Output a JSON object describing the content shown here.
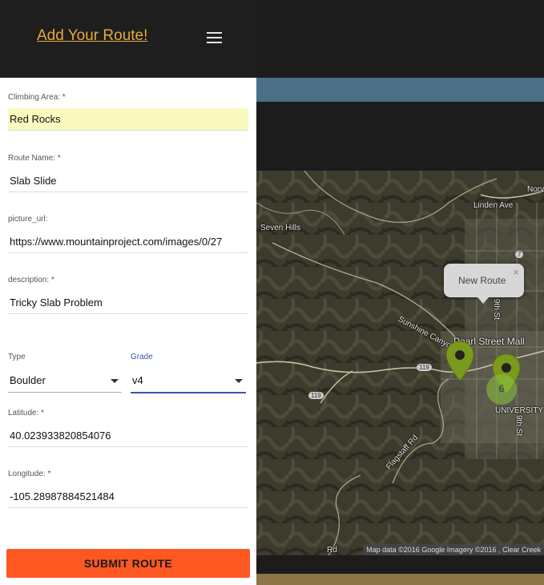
{
  "header": {
    "title": "Add Your Route!",
    "menu_icon": "hamburger-menu-icon"
  },
  "form": {
    "area": {
      "label": "Climbing Area: *",
      "value": "Red Rocks"
    },
    "route_name": {
      "label": "Route Name: *",
      "value": "Slab Slide"
    },
    "picture_url": {
      "label": "picture_url:",
      "value": "https://www.mountainproject.com/images/0/27"
    },
    "description": {
      "label": "description: *",
      "value": "Tricky Slab Problem"
    },
    "type": {
      "label": "Type",
      "value": "Boulder"
    },
    "grade": {
      "label": "Grade",
      "value": "v4"
    },
    "latitude": {
      "label": "Latitude: *",
      "value": "40.023933820854076"
    },
    "longitude": {
      "label": "Longitude: *",
      "value": "-105.28987884521484"
    },
    "submit_label": "SUBMIT ROUTE"
  },
  "map": {
    "labels": {
      "seven_hills": "Seven Hills",
      "linden_ave": "Linden Ave",
      "sunshine_canyon": "Sunshine Canyon Dr",
      "pearl_street": "Pearl Street Mall",
      "flagstaff": "Flagstaff Rd",
      "university": "UNIVERSITY",
      "nor": "Norv",
      "route_119_a": "119",
      "route_119_b": "119",
      "route_7": "7",
      "street_9th": "9th St",
      "street_9th_b": "9th St",
      "rd": "Rd"
    },
    "popup": {
      "text": "New Route",
      "close": "×"
    },
    "cluster_count": "6",
    "attribution": "Map data ©2016 Google Imagery ©2016 , Clear Creek",
    "colors": {
      "marker": "#7a9a1e",
      "marker_cluster": "#8cc63f"
    }
  }
}
